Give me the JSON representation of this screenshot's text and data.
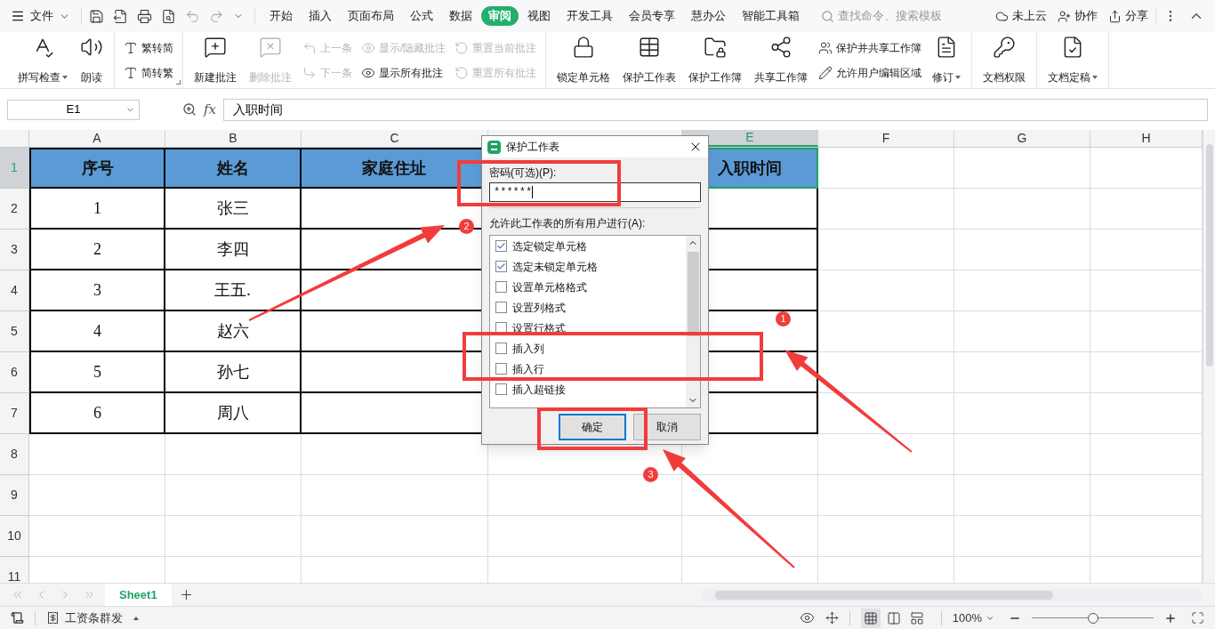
{
  "top_bar": {
    "file_menu": "文件",
    "tabs": [
      {
        "label": "开始",
        "selected": false
      },
      {
        "label": "插入",
        "selected": false
      },
      {
        "label": "页面布局",
        "selected": false
      },
      {
        "label": "公式",
        "selected": false
      },
      {
        "label": "数据",
        "selected": false
      },
      {
        "label": "审阅",
        "selected": true
      },
      {
        "label": "视图",
        "selected": false
      },
      {
        "label": "开发工具",
        "selected": false
      },
      {
        "label": "会员专享",
        "selected": false
      },
      {
        "label": "慧办公",
        "selected": false
      },
      {
        "label": "智能工具箱",
        "selected": false
      }
    ],
    "search": {
      "placeholder": "查找命令、搜索模板"
    },
    "actions": [
      "未上云",
      "协作",
      "分享"
    ]
  },
  "ribbon": {
    "groups": [
      {
        "columns": [
          {
            "kind": "large",
            "items": [
              {
                "label": "拼写检查",
                "disabled": false,
                "dropdown": true
              }
            ]
          },
          {
            "kind": "large",
            "items": [
              {
                "label": "朗读",
                "disabled": false
              }
            ]
          }
        ]
      },
      {
        "launcher": true,
        "columns": [
          {
            "kind": "stack",
            "items": [
              {
                "label": "繁转简",
                "disabled": false
              },
              {
                "label": "简转繁",
                "disabled": false
              }
            ]
          }
        ]
      },
      {
        "columns": [
          {
            "kind": "large",
            "items": [
              {
                "label": "新建批注",
                "disabled": false
              }
            ]
          },
          {
            "kind": "large",
            "items": [
              {
                "label": "删除批注",
                "disabled": true
              }
            ]
          },
          {
            "kind": "stack",
            "items": [
              {
                "label": "上一条",
                "disabled": true
              },
              {
                "label": "下一条",
                "disabled": true
              }
            ]
          },
          {
            "kind": "stack",
            "items": [
              {
                "label": "显示/隐藏批注",
                "disabled": true
              },
              {
                "label": "显示所有批注",
                "disabled": false
              }
            ]
          },
          {
            "kind": "stack",
            "items": [
              {
                "label": "重置当前批注",
                "disabled": true
              },
              {
                "label": "重置所有批注",
                "disabled": true
              }
            ]
          }
        ]
      },
      {
        "columns": [
          {
            "kind": "large",
            "items": [
              {
                "label": "锁定单元格",
                "disabled": false
              }
            ]
          },
          {
            "kind": "large",
            "items": [
              {
                "label": "保护工作表",
                "disabled": false
              }
            ]
          },
          {
            "kind": "large",
            "items": [
              {
                "label": "保护工作簿",
                "disabled": false
              }
            ]
          },
          {
            "kind": "large",
            "items": [
              {
                "label": "共享工作簿",
                "disabled": false
              }
            ]
          },
          {
            "kind": "stack",
            "items": [
              {
                "label": "保护并共享工作簿",
                "disabled": false
              },
              {
                "label": "允许用户编辑区域",
                "disabled": false
              }
            ]
          },
          {
            "kind": "large",
            "items": [
              {
                "label": "修订",
                "disabled": false,
                "dropdown": true
              }
            ]
          }
        ]
      },
      {
        "columns": [
          {
            "kind": "large",
            "items": [
              {
                "label": "文档权限",
                "disabled": false
              }
            ]
          }
        ]
      },
      {
        "columns": [
          {
            "kind": "large",
            "items": [
              {
                "label": "文档定稿",
                "disabled": false,
                "dropdown": true
              }
            ]
          }
        ]
      }
    ]
  },
  "formula_bar": {
    "cell_ref": "E1",
    "fx_label": "fx",
    "value": "入职时间"
  },
  "sheet": {
    "columns": [
      {
        "kind": "header",
        "label": "A",
        "selected": false
      },
      {
        "kind": "header",
        "label": "B",
        "selected": false
      },
      {
        "kind": "header",
        "label": "C",
        "selected": false
      },
      {
        "kind": "covered"
      },
      {
        "kind": "header",
        "label": "E",
        "selected": true
      },
      {
        "kind": "header",
        "label": "F",
        "selected": false
      },
      {
        "kind": "header",
        "label": "G",
        "selected": false
      },
      {
        "kind": "header",
        "label": "H",
        "selected": false
      }
    ],
    "row_numbers": [
      {
        "label": "1",
        "selected": true
      },
      {
        "label": "2",
        "selected": false
      },
      {
        "label": "3",
        "selected": false
      },
      {
        "label": "4",
        "selected": false
      },
      {
        "label": "5",
        "selected": false
      },
      {
        "label": "6",
        "selected": false
      },
      {
        "label": "7",
        "selected": false
      },
      {
        "label": "8",
        "selected": false
      },
      {
        "label": "9",
        "selected": false
      },
      {
        "label": "10",
        "selected": false
      },
      {
        "label": "11",
        "selected": false
      }
    ],
    "table_rows": [
      {
        "kind": "header",
        "cells": {
          "a": "序号",
          "b": "姓名",
          "c": "家庭住址",
          "e": "入职时间"
        }
      },
      {
        "kind": "body",
        "cells": {
          "a": "1",
          "b": "张三"
        }
      },
      {
        "kind": "body",
        "cells": {
          "a": "2",
          "b": "李四"
        }
      },
      {
        "kind": "body",
        "cells": {
          "a": "3",
          "b": "王五."
        }
      },
      {
        "kind": "body",
        "cells": {
          "a": "4",
          "b": "赵六"
        }
      },
      {
        "kind": "body",
        "cells": {
          "a": "5",
          "b": "孙七"
        }
      },
      {
        "kind": "body",
        "cells": {
          "a": "6",
          "b": "周八"
        }
      }
    ]
  },
  "dialog": {
    "title": "保护工作表",
    "password_label": "密码(可选)(P):",
    "password_value": "******",
    "permissions_label": "允许此工作表的所有用户进行(A):",
    "options": [
      {
        "label": "选定锁定单元格",
        "checked": true
      },
      {
        "label": "选定未锁定单元格",
        "checked": true
      },
      {
        "label": "设置单元格格式",
        "checked": false
      },
      {
        "label": "设置列格式",
        "checked": false
      },
      {
        "label": "设置行格式",
        "checked": false
      },
      {
        "label": "插入列",
        "checked": false
      },
      {
        "label": "插入行",
        "checked": false
      },
      {
        "label": "插入超链接",
        "checked": false
      }
    ],
    "buttons": [
      {
        "label": "确定",
        "selected": true
      },
      {
        "label": "取消",
        "selected": false
      }
    ]
  },
  "sheet_tabs": [
    {
      "label": "Sheet1",
      "selected": true
    }
  ],
  "status_bar": {
    "tool": "工资条群发",
    "zoom": "100%",
    "zoom_slider": {
      "level": 0.5
    },
    "views": [
      {
        "selected": true
      },
      {
        "selected": false
      },
      {
        "selected": false
      }
    ]
  },
  "annotations": {
    "markers": [
      {
        "label": "2"
      },
      {
        "label": "1"
      },
      {
        "label": "3"
      }
    ]
  }
}
